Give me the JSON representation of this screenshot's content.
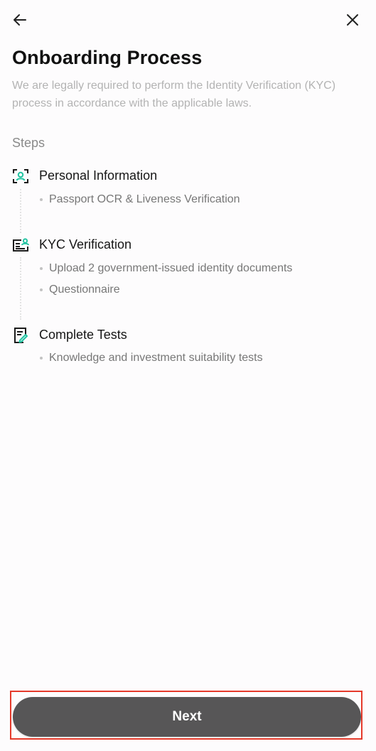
{
  "header": {
    "back_icon": "arrow-left-icon",
    "close_icon": "close-icon"
  },
  "page": {
    "title": "Onboarding Process",
    "subtitle": "We are legally required to perform the Identity Verification (KYC) process in accordance with the applicable laws.",
    "steps_label": "Steps"
  },
  "steps": [
    {
      "icon": "face-scan-icon",
      "title": "Personal Information",
      "items": [
        "Passport OCR & Liveness Verification"
      ]
    },
    {
      "icon": "id-card-icon",
      "title": "KYC Verification",
      "items": [
        "Upload 2 government-issued identity documents",
        "Questionnaire"
      ]
    },
    {
      "icon": "test-document-icon",
      "title": "Complete Tests",
      "items": [
        "Knowledge and investment suitability tests"
      ]
    }
  ],
  "footer": {
    "next_label": "Next"
  },
  "colors": {
    "accent": "#23c4a2",
    "button": "#575657",
    "highlight": "#e53a2b"
  }
}
